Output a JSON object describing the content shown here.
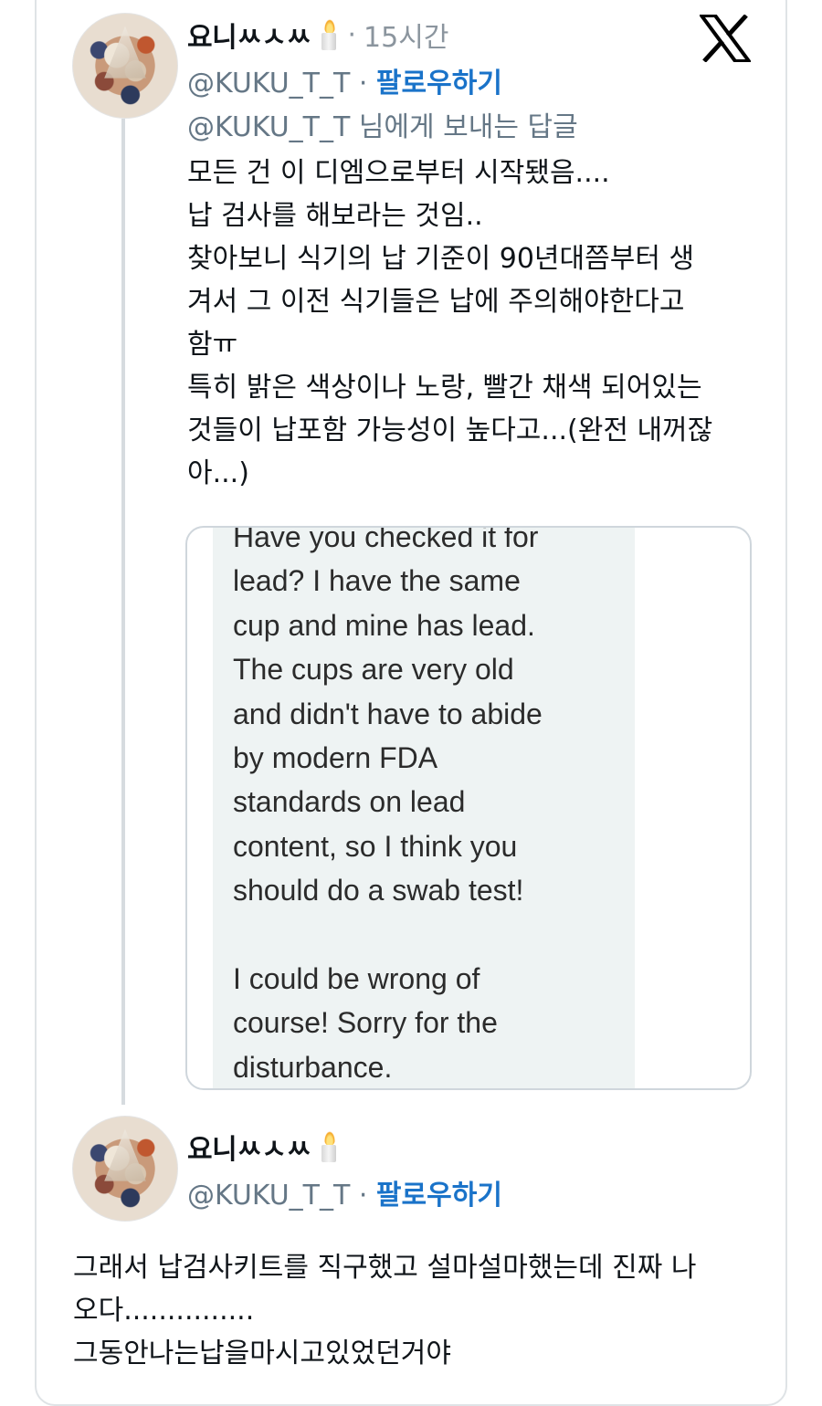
{
  "tweet1": {
    "display_name": "요니ㅆㅅㅆ",
    "time_separator": "·",
    "time": "15시간",
    "handle": "@KUKU_T_T",
    "handle_separator": " · ",
    "follow_label": "팔로우하기",
    "reply_to": "@KUKU_T_T 님에게 보내는 답글",
    "text": "모든 건 이 디엠으로부터 시작됐음....\n납 검사를 해보라는 것임..\n찾아보니 식기의 납 기준이 90년대쯤부터 생\n겨서 그 이전 식기들은 납에 주의해야한다고\n함ㅠ\n특히 밝은 색상이나 노랑, 빨간 채색 되어있는\n것들이 납포함 가능성이 높다고...(완전 내꺼잖\n아...)",
    "embedded_dm_text": "Have you checked it for\nlead? I have the same\ncup and mine has lead.\nThe cups are very old\nand didn't have to abide\nby modern FDA\nstandards on lead\ncontent, so I think you\nshould do a swab test!\n\nI could be wrong of\ncourse! Sorry for the\ndisturbance."
  },
  "tweet2": {
    "display_name": "요니ㅆㅅㅆ",
    "handle": "@KUKU_T_T",
    "handle_separator": " · ",
    "follow_label": "팔로우하기",
    "text": "그래서 납검사키트를 직구했고 설마설마했는데 진짜 나\n오다...............\n그동안나는납을마시고있었던거야"
  },
  "icons": {
    "brand": "x-logo-icon",
    "emoji": "candle-icon"
  },
  "colors": {
    "follow": "#1a73c9",
    "secondary_text": "#657786",
    "border": "#dfe3e6",
    "dm_background": "#eef3f3"
  }
}
